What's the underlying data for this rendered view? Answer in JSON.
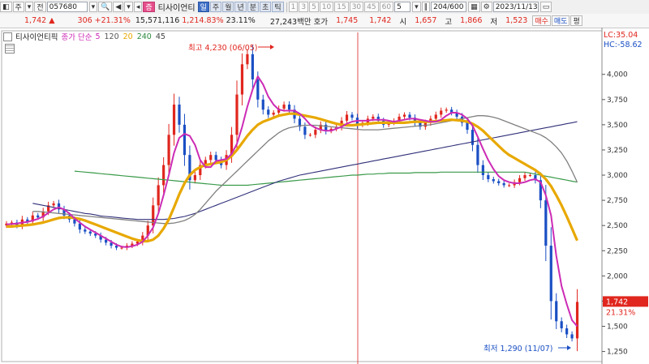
{
  "toolbar": {
    "market_btn": "주",
    "type_btn": "전",
    "code": "057680",
    "badge": "증",
    "stock_name": "티사이언티",
    "periods": [
      "일",
      "주",
      "월",
      "년",
      "분",
      "초",
      "틱"
    ],
    "active_period": 0,
    "intervals": [
      "1",
      "3",
      "5",
      "10",
      "15",
      "30",
      "45",
      "60"
    ],
    "interval_select": "5",
    "count": "204/600",
    "date": "2023/11/13"
  },
  "quote": {
    "price": "1,742",
    "change": "306",
    "change_rate": "+21.31%",
    "volume": "15,571,116",
    "volume_rate": "1,214.83%",
    "turnover": "23.11%",
    "amount": "27,243백만",
    "ask_label": "호가",
    "ask": "1,745",
    "bid": "1,742",
    "open_label": "시",
    "open": "1,657",
    "high_label": "고",
    "high": "1,866",
    "low_label": "저",
    "low": "1,523",
    "buy_btn": "매수",
    "sell_btn": "매도",
    "eval_btn": "평"
  },
  "legend": {
    "name": "티사이언티픽",
    "ma_label": "종가 단순",
    "periods": [
      "5",
      "120",
      "20",
      "240",
      "45"
    ],
    "colors": [
      "#cc2bb5",
      "#555555",
      "#e8a800",
      "#2b8a3e",
      "#444444"
    ]
  },
  "colors": {
    "up": "#e0261e",
    "down": "#1a4fc4",
    "ma5": "#cc2bb5",
    "ma20": "#e8a800",
    "ma45": "#808080",
    "ma120": "#30307a",
    "ma240": "#3a9a4a",
    "vline": "#e05050"
  },
  "chart_data": {
    "type": "line",
    "ylim": [
      1150,
      4400
    ],
    "y_ticks": [
      1250,
      1500,
      1750,
      2000,
      2250,
      2500,
      2750,
      3000,
      3250,
      3500,
      3750,
      4000
    ],
    "y_tick_labels": [
      "1,250",
      "1,500",
      "1,750",
      "2,000",
      "2,250",
      "2,500",
      "2,750",
      "3,000",
      "3,250",
      "3,500",
      "3,750",
      "4,000"
    ],
    "lc": "LC:35.04",
    "hc": "HC:-58.62",
    "current_price": 1742,
    "current_label": "1,742",
    "current_rate": "21.31%",
    "max_annotation": "최고 4,230 (06/05)",
    "min_annotation": "최저 1,290 (11/07)",
    "n_bars": 120,
    "close": [
      2520,
      2530,
      2500,
      2560,
      2540,
      2600,
      2580,
      2640,
      2700,
      2720,
      2660,
      2600,
      2560,
      2520,
      2460,
      2440,
      2420,
      2400,
      2360,
      2330,
      2300,
      2280,
      2280,
      2300,
      2320,
      2340,
      2400,
      2500,
      2700,
      2900,
      3100,
      3400,
      3700,
      3500,
      3200,
      2950,
      3000,
      3100,
      3150,
      3200,
      3150,
      3100,
      3200,
      3400,
      3800,
      4100,
      4200,
      3950,
      3750,
      3650,
      3600,
      3620,
      3660,
      3700,
      3650,
      3560,
      3480,
      3400,
      3400,
      3450,
      3500,
      3440,
      3460,
      3480,
      3540,
      3600,
      3570,
      3500,
      3520,
      3560,
      3580,
      3540,
      3500,
      3520,
      3540,
      3580,
      3600,
      3570,
      3520,
      3480,
      3520,
      3560,
      3600,
      3640,
      3650,
      3620,
      3580,
      3520,
      3450,
      3300,
      3100,
      3000,
      2960,
      2940,
      2920,
      2900,
      2900,
      2930,
      2970,
      3000,
      3000,
      2950,
      2750,
      2300,
      1750,
      1550,
      1480,
      1420,
      1380,
      1742
    ],
    "ma5": [
      2510,
      2515,
      2520,
      2530,
      2535,
      2550,
      2565,
      2590,
      2625,
      2660,
      2680,
      2660,
      2620,
      2570,
      2530,
      2490,
      2460,
      2430,
      2400,
      2370,
      2340,
      2310,
      2290,
      2285,
      2295,
      2310,
      2340,
      2400,
      2480,
      2620,
      2800,
      3000,
      3220,
      3370,
      3410,
      3390,
      3300,
      3150,
      3080,
      3080,
      3140,
      3150,
      3160,
      3210,
      3310,
      3480,
      3680,
      3850,
      3980,
      3900,
      3780,
      3700,
      3650,
      3640,
      3640,
      3640,
      3610,
      3560,
      3500,
      3470,
      3450,
      3440,
      3440,
      3460,
      3480,
      3510,
      3530,
      3540,
      3540,
      3540,
      3550,
      3550,
      3550,
      3540,
      3530,
      3540,
      3550,
      3560,
      3560,
      3550,
      3540,
      3530,
      3530,
      3550,
      3590,
      3620,
      3620,
      3600,
      3560,
      3490,
      3380,
      3260,
      3150,
      3060,
      2990,
      2950,
      2930,
      2920,
      2920,
      2930,
      2950,
      2960,
      2930,
      2800,
      2600,
      2200,
      1900,
      1720,
      1560,
      1500
    ],
    "ma20": [
      2490,
      2490,
      2495,
      2500,
      2505,
      2510,
      2520,
      2530,
      2545,
      2560,
      2575,
      2580,
      2580,
      2575,
      2565,
      2550,
      2530,
      2510,
      2490,
      2470,
      2450,
      2430,
      2410,
      2390,
      2370,
      2355,
      2345,
      2345,
      2360,
      2400,
      2470,
      2560,
      2680,
      2810,
      2920,
      3000,
      3050,
      3080,
      3100,
      3110,
      3120,
      3130,
      3150,
      3190,
      3250,
      3320,
      3390,
      3450,
      3500,
      3530,
      3550,
      3570,
      3590,
      3600,
      3610,
      3610,
      3600,
      3590,
      3580,
      3570,
      3555,
      3540,
      3525,
      3510,
      3500,
      3495,
      3495,
      3500,
      3505,
      3510,
      3515,
      3520,
      3520,
      3520,
      3520,
      3520,
      3520,
      3525,
      3530,
      3530,
      3530,
      3530,
      3535,
      3540,
      3545,
      3550,
      3545,
      3540,
      3530,
      3510,
      3480,
      3440,
      3390,
      3340,
      3290,
      3240,
      3200,
      3170,
      3140,
      3110,
      3080,
      3050,
      3010,
      2960,
      2890,
      2800,
      2700,
      2590,
      2470,
      2350
    ],
    "ma45": [
      2640,
      2640,
      2635,
      2630,
      2625,
      2620,
      2615,
      2610,
      2605,
      2600,
      2595,
      2590,
      2585,
      2580,
      2575,
      2570,
      2565,
      2560,
      2555,
      2550,
      2545,
      2540,
      2535,
      2530,
      2525,
      2520,
      2520,
      2525,
      2535,
      2550,
      2575,
      2610,
      2660,
      2720,
      2780,
      2840,
      2890,
      2940,
      2990,
      3040,
      3090,
      3140,
      3190,
      3240,
      3290,
      3340,
      3380,
      3420,
      3450,
      3470,
      3480,
      3490,
      3495,
      3495,
      3495,
      3490,
      3485,
      3480,
      3475,
      3470,
      3465,
      3460,
      3455,
      3450,
      3450,
      3450,
      3450,
      3455,
      3460,
      3465,
      3470,
      3475,
      3480,
      3485,
      3490,
      3495,
      3500,
      3510,
      3520,
      3530,
      3540,
      3550,
      3560,
      3570,
      3580,
      3590,
      3590,
      3585,
      3575,
      3560,
      3540,
      3520,
      3500,
      3480,
      3460,
      3440,
      3420,
      3400,
      3370,
      3330,
      3280,
      3220,
      3140,
      3040,
      2930
    ],
    "ma120": [
      2720,
      2710,
      2700,
      2690,
      2680,
      2670,
      2660,
      2650,
      2640,
      2630,
      2620,
      2615,
      2605,
      2595,
      2590,
      2585,
      2580,
      2575,
      2570,
      2565,
      2560,
      2560,
      2560,
      2560,
      2560,
      2560,
      2565,
      2570,
      2580,
      2590,
      2605,
      2620,
      2640,
      2660,
      2680,
      2700,
      2720,
      2740,
      2760,
      2780,
      2800,
      2820,
      2840,
      2860,
      2880,
      2900,
      2920,
      2940,
      2955,
      2970,
      2985,
      3000,
      3010,
      3020,
      3030,
      3040,
      3050,
      3060,
      3070,
      3080,
      3090,
      3100,
      3110,
      3120,
      3130,
      3140,
      3150,
      3160,
      3170,
      3180,
      3190,
      3200,
      3210,
      3220,
      3230,
      3240,
      3250,
      3260,
      3270,
      3280,
      3290,
      3300,
      3310,
      3320,
      3330,
      3340,
      3350,
      3360,
      3370,
      3380,
      3390,
      3400,
      3410,
      3420,
      3430,
      3440,
      3450,
      3460,
      3470,
      3480,
      3490,
      3500,
      3510,
      3520,
      3530
    ],
    "ma240": [
      3040,
      3035,
      3030,
      3025,
      3020,
      3015,
      3010,
      3005,
      3000,
      2995,
      2990,
      2985,
      2980,
      2975,
      2970,
      2965,
      2960,
      2955,
      2950,
      2945,
      2940,
      2935,
      2930,
      2925,
      2920,
      2915,
      2910,
      2905,
      2900,
      2900,
      2900,
      2900,
      2900,
      2900,
      2905,
      2910,
      2915,
      2920,
      2925,
      2930,
      2935,
      2940,
      2945,
      2950,
      2955,
      2960,
      2965,
      2970,
      2975,
      2980,
      2985,
      2990,
      2995,
      3000,
      3000,
      3005,
      3010,
      3010,
      3015,
      3015,
      3020,
      3020,
      3020,
      3020,
      3020,
      3025,
      3025,
      3025,
      3025,
      3025,
      3030,
      3030,
      3030,
      3030,
      3030,
      3030,
      3030,
      3030,
      3030,
      3030,
      3030,
      3030,
      3030,
      3030,
      3030,
      3030,
      3030,
      3020,
      3010,
      3000,
      2990,
      2980,
      2970,
      2960,
      2950,
      2940,
      2930
    ]
  }
}
